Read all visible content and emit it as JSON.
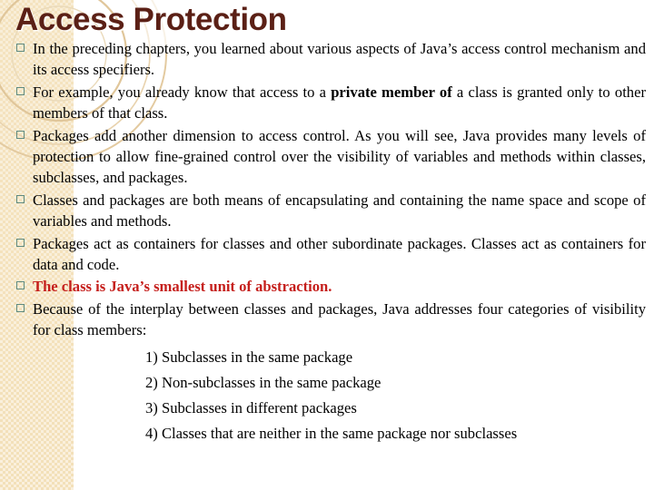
{
  "slide": {
    "title": "Access Protection",
    "title_color": "#5b2016",
    "background_color": "#ffffff",
    "sidebar_color": "#f3e0b9",
    "bullet_marker_color": "#5e8a7f",
    "highlight_color": "#c51f1c"
  },
  "bullets": [
    {
      "marker": "hollow-square",
      "segments": [
        {
          "text": "In the preceding chapters, you learned about various aspects of Java’s access control mechanism and its access specifiers.",
          "bold": false
        }
      ],
      "emphasis": false
    },
    {
      "marker": "hollow-square",
      "segments": [
        {
          "text": "For example, you already know that access to a ",
          "bold": false
        },
        {
          "text": "private member of",
          "bold": true
        },
        {
          "text": " a class is granted only to other members of that class.",
          "bold": false
        }
      ],
      "emphasis": false
    },
    {
      "marker": "hollow-square",
      "segments": [
        {
          "text": "Packages add another dimension to access control. As you will see, Java provides many levels of protection to allow fine-grained control over the visibility of variables and methods within classes, subclasses, and packages.",
          "bold": false
        }
      ],
      "emphasis": false
    },
    {
      "marker": "hollow-square",
      "segments": [
        {
          "text": "Classes and packages are both means of encapsulating and containing the name space and scope of variables and methods.",
          "bold": false
        }
      ],
      "emphasis": false
    },
    {
      "marker": "hollow-square",
      "segments": [
        {
          "text": "Packages act as containers for classes and other subordinate packages. Classes act as containers for data and code.",
          "bold": false
        }
      ],
      "emphasis": false
    },
    {
      "marker": "hollow-square",
      "segments": [
        {
          "text": "The class is Java’s smallest unit of abstraction.",
          "bold": false
        }
      ],
      "emphasis": true
    },
    {
      "marker": "hollow-square",
      "segments": [
        {
          "text": "Because of the interplay between classes and packages, Java addresses four categories of visibility for class members:",
          "bold": false
        }
      ],
      "emphasis": false
    }
  ],
  "numbered_list": [
    "1) Subclasses in the same package",
    "2) Non-subclasses in the same package",
    "3) Subclasses in different packages",
    "4) Classes that are neither in the same package nor subclasses"
  ]
}
